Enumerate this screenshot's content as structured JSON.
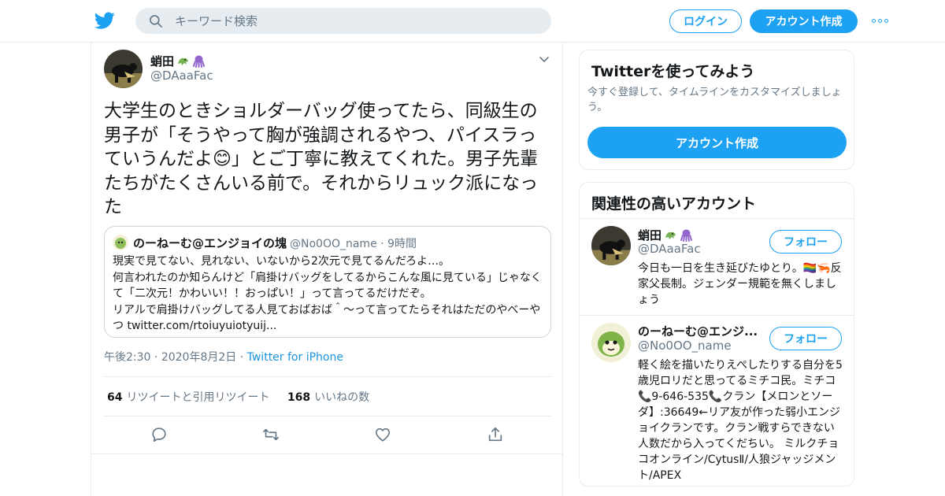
{
  "header": {
    "search_placeholder": "キーワード検索",
    "login_label": "ログイン",
    "signup_label": "アカウント作成"
  },
  "tweet": {
    "author_name": "蛸田",
    "author_handle": "@DAaaFac",
    "text": "大学生のときショルダーバッグ使ってたら、同級生の男子が「そうやって胸が強調されるやつ、パイスラっていうんだよ😊」とご丁寧に教えてくれた。男子先輩たちがたくさんいる前で。それからリュック派になった",
    "quoted": {
      "name": "のーねーむ@エンジョイの塊",
      "handle": "@No0OO_name",
      "time": "9時間",
      "text": "現実で見てない、見れない、いないから2次元で見てるんだろよ…。\n何言われたのか知らんけど「肩掛けバッグをしてるからこんな風に見ている」じゃなくて「二次元！かわいい！！おっぱい！」って言ってるだけだぞ。\nリアルで肩掛けバッグしてる人見ておばおば＾〜って言ってたらそれはただのやべーやつ twitter.com/rtoiuyuiotyuij..."
    },
    "time": "午後2:30",
    "date": "2020年8月2日",
    "source": "Twitter for iPhone",
    "retweets_count": "64",
    "retweets_label": "リツイートと引用リツイート",
    "likes_count": "168",
    "likes_label": "いいねの数"
  },
  "sidebar": {
    "signup_card": {
      "title": "Twitterを使ってみよう",
      "subtitle": "今すぐ登録して、タイムラインをカスタマイズしましょう。",
      "button_label": "アカウント作成"
    },
    "related": {
      "title": "関連性の高いアカウント",
      "follow_label": "フォロー",
      "accounts": [
        {
          "name": "蛸田",
          "handle": "@DAaaFac",
          "bio": "今日も一日を生き延びたゆとり。🏳️‍🌈🦐反家父長制。ジェンダー規範を無くしましょう"
        },
        {
          "name": "のーねーむ@エンジ...",
          "handle": "@No0OO_name",
          "bio": "軽く絵を描いたりえぺしたりする自分を5歳児ロリだと思ってるミチコ民。ミチコ📞9-646-535📞クラン【メロンとソーダ】:36649←リア友が作った弱小エンジョイクランです。クラン戦すらできない人数だから入ってくだちい。 ミルクチョコオンライン/CytusⅡ/人狼ジャッジメント/APEX"
        }
      ]
    }
  },
  "colors": {
    "accent": "#1da1f2",
    "link": "#1b95e0",
    "secondary_text": "#657786",
    "border": "#e6ecf0"
  }
}
